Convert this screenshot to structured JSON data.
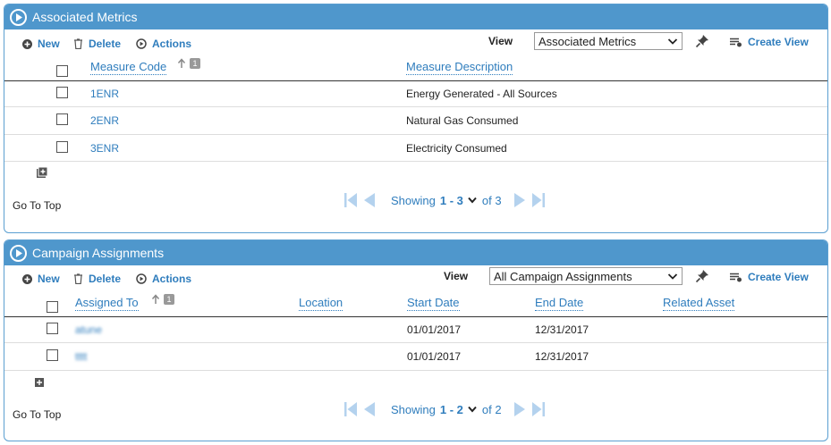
{
  "colors": {
    "header_bg": "#4f97cc",
    "link": "#2f7dbd",
    "pager_icon": "#b4d2ee"
  },
  "metrics": {
    "title": "Associated Metrics",
    "toolbar": {
      "new_label": "New",
      "delete_label": "Delete",
      "actions_label": "Actions",
      "view_label": "View",
      "view_value": "Associated Metrics",
      "create_view_label": "Create View"
    },
    "columns": {
      "code": "Measure Code",
      "description": "Measure Description",
      "sort_index": "1"
    },
    "rows": [
      {
        "code": "1ENR",
        "description": "Energy Generated - All Sources"
      },
      {
        "code": "2ENR",
        "description": "Natural Gas Consumed"
      },
      {
        "code": "3ENR",
        "description": "Electricity Consumed"
      }
    ],
    "go_top": "Go To Top",
    "pager": {
      "showing": "Showing",
      "range": "1 - 3",
      "of": "of 3"
    }
  },
  "campaign": {
    "title": "Campaign Assignments",
    "toolbar": {
      "new_label": "New",
      "delete_label": "Delete",
      "actions_label": "Actions",
      "view_label": "View",
      "view_value": "All Campaign Assignments",
      "create_view_label": "Create View"
    },
    "columns": {
      "assigned_to": "Assigned To",
      "location": "Location",
      "start_date": "Start Date",
      "end_date": "End Date",
      "related_asset": "Related Asset",
      "sort_index": "1"
    },
    "rows": [
      {
        "assigned_to": "atune",
        "start_date": "01/01/2017",
        "end_date": "12/31/2017"
      },
      {
        "assigned_to": "tttt",
        "start_date": "01/01/2017",
        "end_date": "12/31/2017"
      }
    ],
    "go_top": "Go To Top",
    "pager": {
      "showing": "Showing",
      "range": "1 - 2",
      "of": "of 2"
    }
  }
}
